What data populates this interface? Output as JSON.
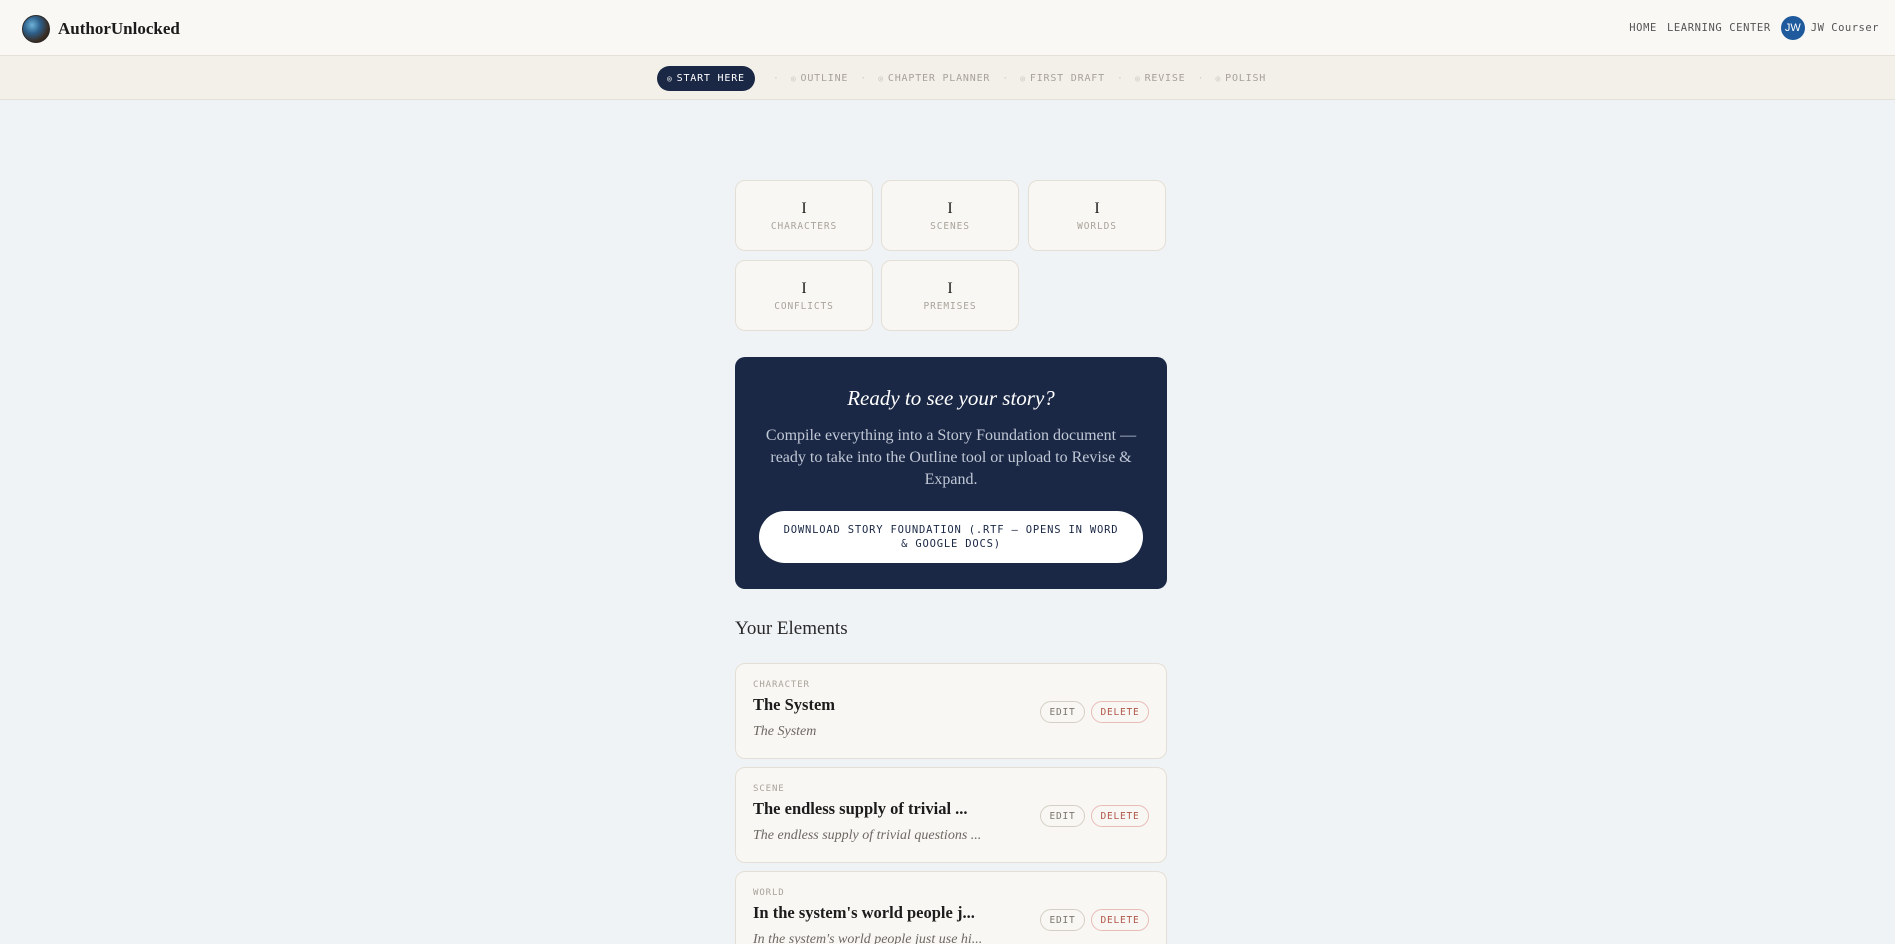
{
  "header": {
    "brand": "AuthorUnlocked",
    "nav": [
      "HOME",
      "LEARNING CENTER"
    ],
    "avatar_initials": "JW",
    "username": "JW Courser"
  },
  "steps": {
    "active": "START HERE",
    "items": [
      "OUTLINE",
      "CHAPTER PLANNER",
      "FIRST DRAFT",
      "REVISE",
      "POLISH"
    ]
  },
  "stats": [
    {
      "count": "I",
      "label": "CHARACTERS"
    },
    {
      "count": "I",
      "label": "SCENES"
    },
    {
      "count": "I",
      "label": "WORLDS"
    },
    {
      "count": "I",
      "label": "CONFLICTS"
    },
    {
      "count": "I",
      "label": "PREMISES"
    }
  ],
  "cta": {
    "title": "Ready to see your story?",
    "body": "Compile everything into a Story Foundation document — ready to take into the Outline tool or upload to Revise & Expand.",
    "button": "DOWNLOAD STORY FOUNDATION (.RTF — OPENS IN WORD & GOOGLE DOCS)"
  },
  "elements": {
    "title": "Your Elements",
    "edit_label": "EDIT",
    "delete_label": "DELETE",
    "items": [
      {
        "type": "CHARACTER",
        "name": "The System",
        "desc": "The System"
      },
      {
        "type": "SCENE",
        "name": "The endless supply of trivial ...",
        "desc": "The endless supply of trivial questions ..."
      },
      {
        "type": "WORLD",
        "name": "In the system's world people j...",
        "desc": "In the system's world people just use hi..."
      }
    ]
  },
  "colors": {
    "navy": "#1a2845",
    "avatar": "#1e5a9c",
    "delete": "#b0574b"
  }
}
